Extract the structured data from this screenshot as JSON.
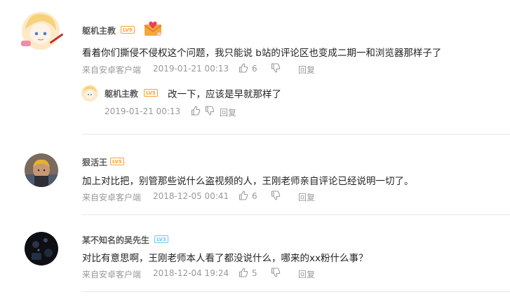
{
  "comments": [
    {
      "username": "躯机主教",
      "level": "LV5",
      "text": "看着你们撕侵不侵权这个问题，我只能说 b站的评论区也变成二期一和浏览器那样子了",
      "source": "来自安卓客户端",
      "time": "2019-01-21 00:13",
      "likes": "6",
      "reply_label": "回复",
      "reply": {
        "username": "躯机主教",
        "level": "LV5",
        "text": "改一下，应该是早就那样了",
        "time": "2019-01-21 00:13",
        "reply_label": "回复"
      }
    },
    {
      "username": "狠活王",
      "level": "LV5",
      "text": "加上对比把，别管那些说什么盗视频的人，王刚老师亲自评论已经说明一切了。",
      "source": "来自安卓客户端",
      "time": "2018-12-05 00:41",
      "likes": "6",
      "reply_label": "回复"
    },
    {
      "username": "某不知名的吴先生",
      "level": "LV3",
      "text": "对比有意思啊，王刚老师本人看了都没说什么，哪来的xx粉什么事？",
      "source": "来自安卓客户端",
      "time": "2018-12-04 19:24",
      "likes": "5",
      "reply_label": "回复"
    }
  ],
  "colors": {
    "level_orange": "#f3a034",
    "level_blue": "#6ec7f0",
    "meta_gray": "#999999",
    "divider": "#e5e9ef"
  }
}
